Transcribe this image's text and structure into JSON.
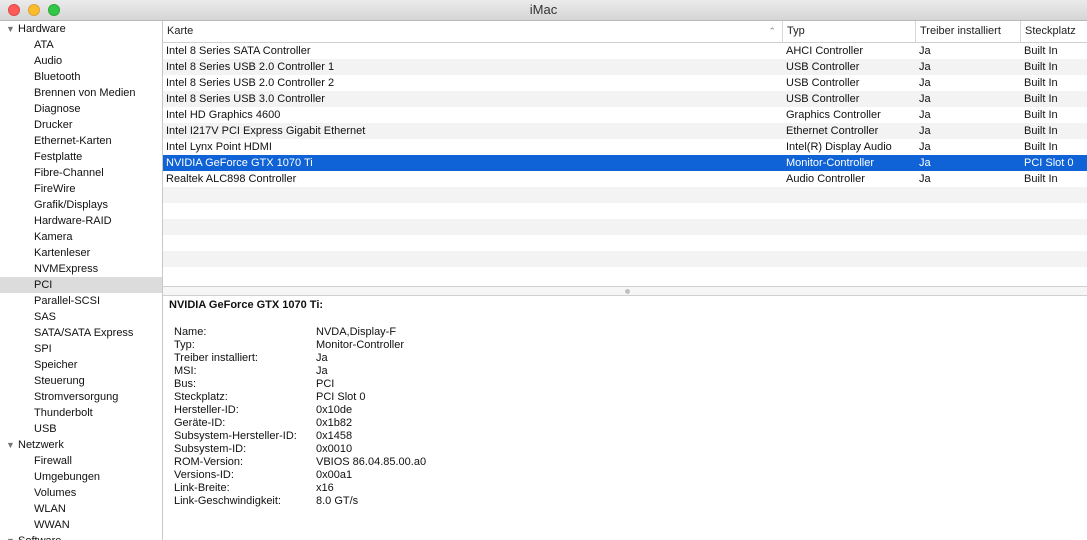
{
  "window": {
    "title": "iMac",
    "colors": {
      "close": "#fc5b57",
      "minimize": "#e5bf3c",
      "zoom": "#57c038",
      "selection": "#0f63d6"
    }
  },
  "sidebar": {
    "groups": [
      {
        "label": "Hardware",
        "items": [
          "ATA",
          "Audio",
          "Bluetooth",
          "Brennen von Medien",
          "Diagnose",
          "Drucker",
          "Ethernet-Karten",
          "Festplatte",
          "Fibre-Channel",
          "FireWire",
          "Grafik/Displays",
          "Hardware-RAID",
          "Kamera",
          "Kartenleser",
          "NVMExpress",
          "PCI",
          "Parallel-SCSI",
          "SAS",
          "SATA/SATA Express",
          "SPI",
          "Speicher",
          "Steuerung",
          "Stromversorgung",
          "Thunderbolt",
          "USB"
        ]
      },
      {
        "label": "Netzwerk",
        "items": [
          "Firewall",
          "Umgebungen",
          "Volumes",
          "WLAN",
          "WWAN"
        ]
      },
      {
        "label": "Software",
        "items": []
      }
    ],
    "selected": "PCI"
  },
  "table": {
    "columns": [
      "Karte",
      "Typ",
      "Treiber installiert",
      "Steckplatz"
    ],
    "sort_icon": "chevron-up-icon",
    "rows": [
      [
        "Intel 8 Series SATA Controller",
        "AHCI Controller",
        "Ja",
        "Built In"
      ],
      [
        "Intel 8 Series USB 2.0 Controller 1",
        "USB Controller",
        "Ja",
        "Built In"
      ],
      [
        "Intel 8 Series USB 2.0 Controller 2",
        "USB Controller",
        "Ja",
        "Built In"
      ],
      [
        "Intel 8 Series USB 3.0 Controller",
        "USB Controller",
        "Ja",
        "Built In"
      ],
      [
        "Intel HD Graphics 4600",
        "Graphics Controller",
        "Ja",
        "Built In"
      ],
      [
        "Intel I217V PCI Express Gigabit Ethernet",
        "Ethernet Controller",
        "Ja",
        "Built In"
      ],
      [
        "Intel Lynx Point HDMI",
        "Intel(R) Display Audio",
        "Ja",
        "Built In"
      ],
      [
        "NVIDIA GeForce GTX 1070 Ti",
        "Monitor-Controller",
        "Ja",
        "PCI Slot 0"
      ],
      [
        "Realtek ALC898 Controller",
        "Audio Controller",
        "Ja",
        "Built In"
      ]
    ],
    "selected_index": 7
  },
  "detail": {
    "title": "NVIDIA GeForce GTX 1070 Ti:",
    "fields": [
      [
        "Name:",
        "NVDA,Display-F"
      ],
      [
        "Typ:",
        "Monitor-Controller"
      ],
      [
        "Treiber installiert:",
        "Ja"
      ],
      [
        "MSI:",
        "Ja"
      ],
      [
        "Bus:",
        "PCI"
      ],
      [
        "Steckplatz:",
        "PCI Slot 0"
      ],
      [
        "Hersteller-ID:",
        "0x10de"
      ],
      [
        "Geräte-ID:",
        "0x1b82"
      ],
      [
        "Subsystem-Hersteller-ID:",
        "0x1458"
      ],
      [
        "Subsystem-ID:",
        "0x0010"
      ],
      [
        "ROM-Version:",
        "VBIOS 86.04.85.00.a0"
      ],
      [
        "Versions-ID:",
        "0x00a1"
      ],
      [
        "Link-Breite:",
        "x16"
      ],
      [
        "Link-Geschwindigkeit:",
        "8.0 GT/s"
      ]
    ]
  }
}
